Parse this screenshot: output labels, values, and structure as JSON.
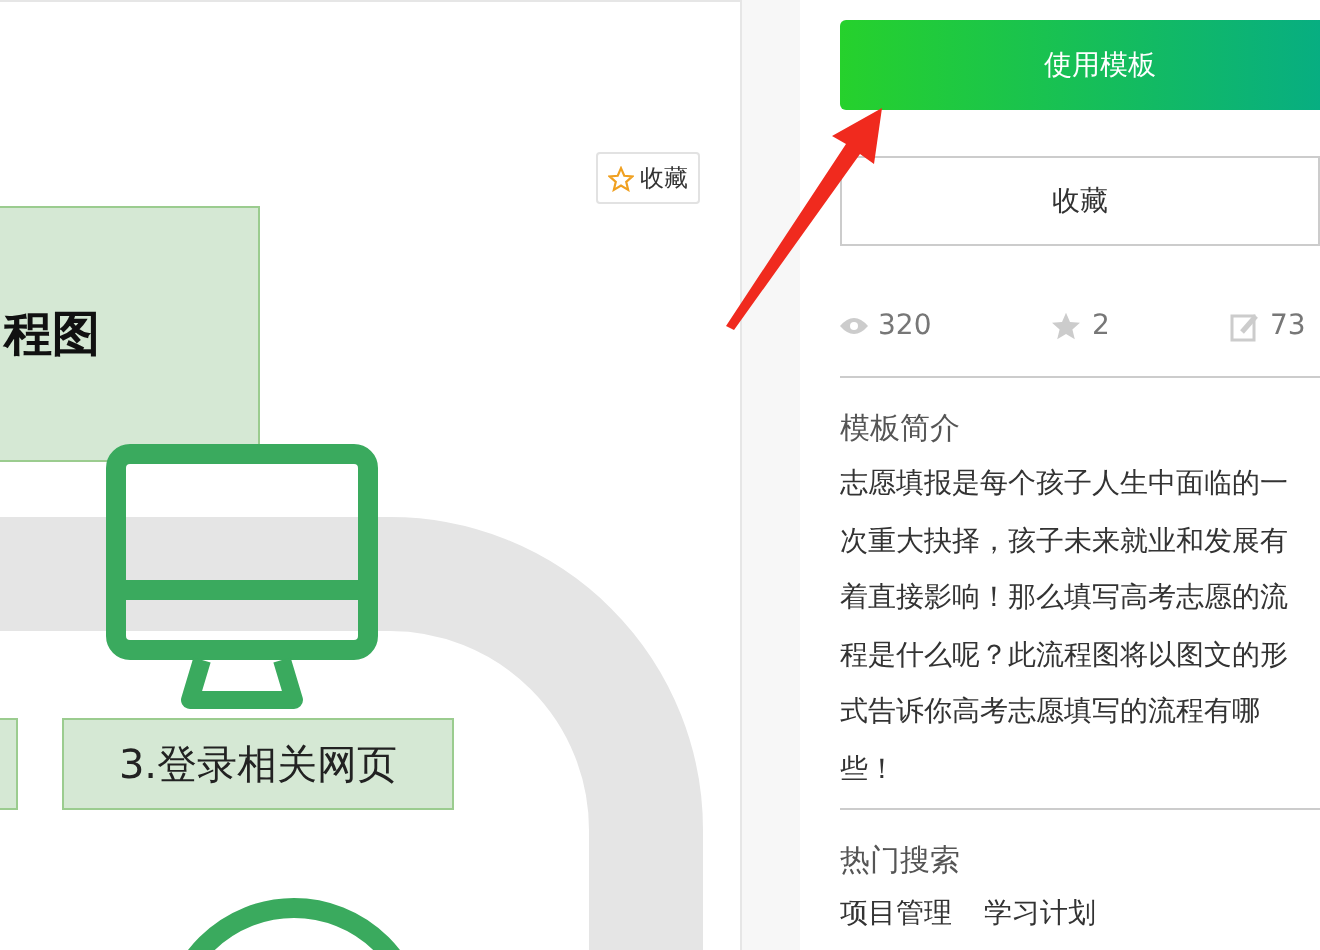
{
  "diagram": {
    "title_box": "程图",
    "step_label": "3.登录相关网页",
    "favorite_button": "收藏"
  },
  "sidebar": {
    "primary_button": "使用模板",
    "secondary_button": "收藏",
    "stats": [
      {
        "kind": "views",
        "value": "320"
      },
      {
        "kind": "stars",
        "value": "2"
      },
      {
        "kind": "edits",
        "value": "73"
      }
    ],
    "intro": {
      "heading": "模板简介",
      "text": "志愿填报是每个孩子人生中面临的一次重大抉择，孩子未来就业和发展有着直接影响！那么填写高考志愿的流程是什么呢？此流程图将以图文的形式告诉你高考志愿填写的流程有哪些！"
    },
    "hot_search": {
      "heading": "热门搜索",
      "tags": [
        "项目管理",
        "学习计划"
      ]
    }
  }
}
